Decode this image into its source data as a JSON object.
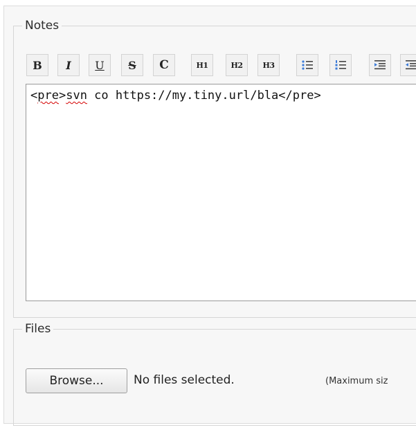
{
  "notes": {
    "legend": "Notes",
    "toolbar": {
      "bold": "B",
      "italic": "I",
      "underline": "U",
      "strike": "S",
      "code": "C",
      "h1": "H1",
      "h2": "H2",
      "h3": "H3",
      "icons": [
        "bullet-list-icon",
        "numbered-list-icon",
        "indent-icon",
        "outdent-icon"
      ]
    },
    "content_prefix": "<",
    "content_word1": "pre",
    "content_mid": ">",
    "content_word2": "svn",
    "content_rest": " co https://my.tiny.url/bla</pre>"
  },
  "files": {
    "legend": "Files",
    "browse_label": "Browse...",
    "status": "No files selected.",
    "max_size_note": "(Maximum siz"
  },
  "colors": {
    "list_icon_blue": "#3b7bd9",
    "spell_error": "#d40000"
  }
}
